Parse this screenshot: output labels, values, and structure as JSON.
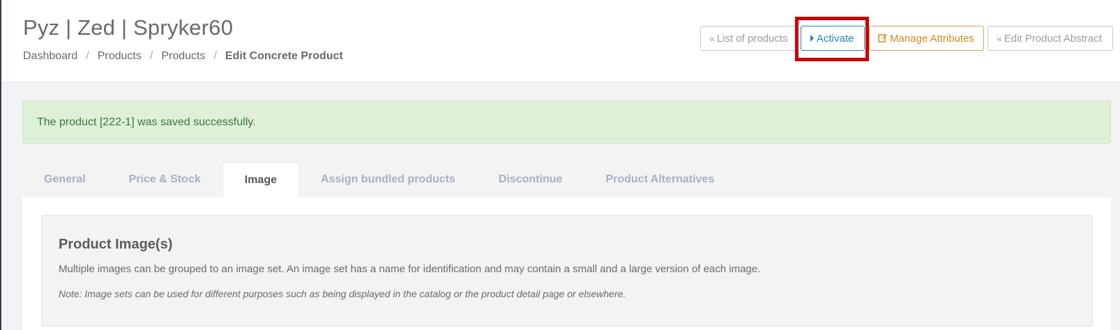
{
  "header": {
    "title": "Pyz | Zed | Spryker60",
    "breadcrumb": [
      "Dashboard",
      "Products",
      "Products",
      "Edit Concrete Product"
    ]
  },
  "actions": {
    "list_of_products": "List of products",
    "activate": "Activate",
    "manage_attributes": "Manage Attributes",
    "edit_product_abstract": "Edit Product Abstract"
  },
  "alert": {
    "message": "The product [222-1] was saved successfully."
  },
  "tabs": [
    {
      "label": "General"
    },
    {
      "label": "Price & Stock"
    },
    {
      "label": "Image",
      "active": true
    },
    {
      "label": "Assign bundled products"
    },
    {
      "label": "Discontinue"
    },
    {
      "label": "Product Alternatives"
    }
  ],
  "image_section": {
    "title": "Product Image(s)",
    "description": "Multiple images can be grouped to an image set. An image set has a name for identification and may contain a small and a large version of each image.",
    "note": "Note: Image sets can be used for different purposes such as being displayed in the catalog or the product detail page or elsewhere."
  },
  "icons": {
    "list": "double-chevron-left-icon",
    "activate": "caret-right-icon",
    "manage": "edit-icon",
    "edit_abstract": "double-chevron-left-icon"
  },
  "colors": {
    "primary": "#1c84c6",
    "warning": "#d48a1c",
    "success_bg": "#dff0d8",
    "success_text": "#3c763d",
    "highlight": "#cc0000"
  }
}
